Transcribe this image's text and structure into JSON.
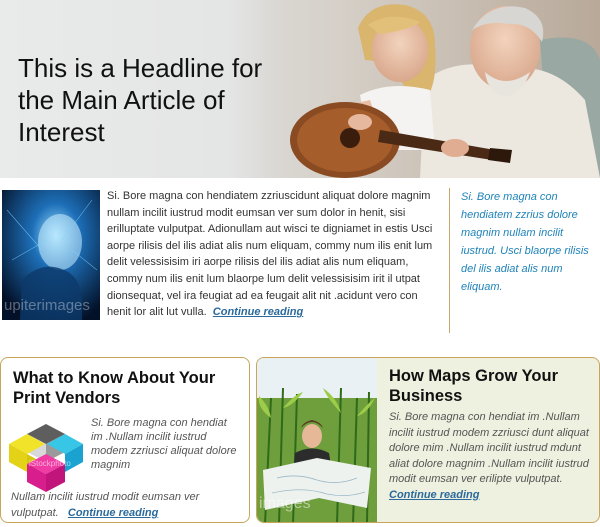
{
  "hero": {
    "headline": "This is a Headline for the Main Article of Interest"
  },
  "main_article": {
    "body": "Si. Bore magna con hendiatem zzriuscidunt aliquat dolore magnim nullam incilit iustrud modit eumsan ver sum dolor in henit, sisi erilluptate vulputpat. Adionullam aut wisci te digniamet in estis Usci aorpe rilisis del ilis adiat alis num eliquam, commy num ilis enit lum delit velessisisim iri aorpe rilisis del ilis adiat alis num eliquam, commy num ilis enit lum blaorpe lum delit velessisisim irit il utpat dionsequat, vel ira feugiat ad ea feugait alit nit .acidunt vero con henit lor alit lut vulla.",
    "more_label": "Continue reading",
    "image_watermark": "upiterimages"
  },
  "sidebar_quote": "Si. Bore magna con hendiatem zzrius dolore magnim nullam incilit iustrud. Usci blaorpe rilisis del ilis adiat alis num eliquam.",
  "box_vendors": {
    "title": "What to Know About Your Print Vendors",
    "text_wrap": "Si. Bore magna con hendiat im .Nullam incilit iustrud modem zzriusci aliquat dolore magnim",
    "text_tail": "Nullam incilit iustrud modit eumsan ver vulputpat.",
    "more_label": "Continue reading",
    "image_watermark": "iStockphoto"
  },
  "box_maps": {
    "title": "How Maps Grow Your Business",
    "text": "Si. Bore magna con hendiat im .Nullam incilit iustrud modem zzriusci dunt aliquat dolore mim .Nullam incilit iustrud mdunt aliat dolore magnim .Nullam incilit iustrud modit eumsan ver erilipte vulputpat.",
    "more_label": "Continue reading",
    "image_watermark": "images"
  },
  "colors": {
    "link": "#2a6a9c",
    "quote": "#1f83b8",
    "box_border": "#c9a55c",
    "box_right_bg": "#eef1df"
  }
}
